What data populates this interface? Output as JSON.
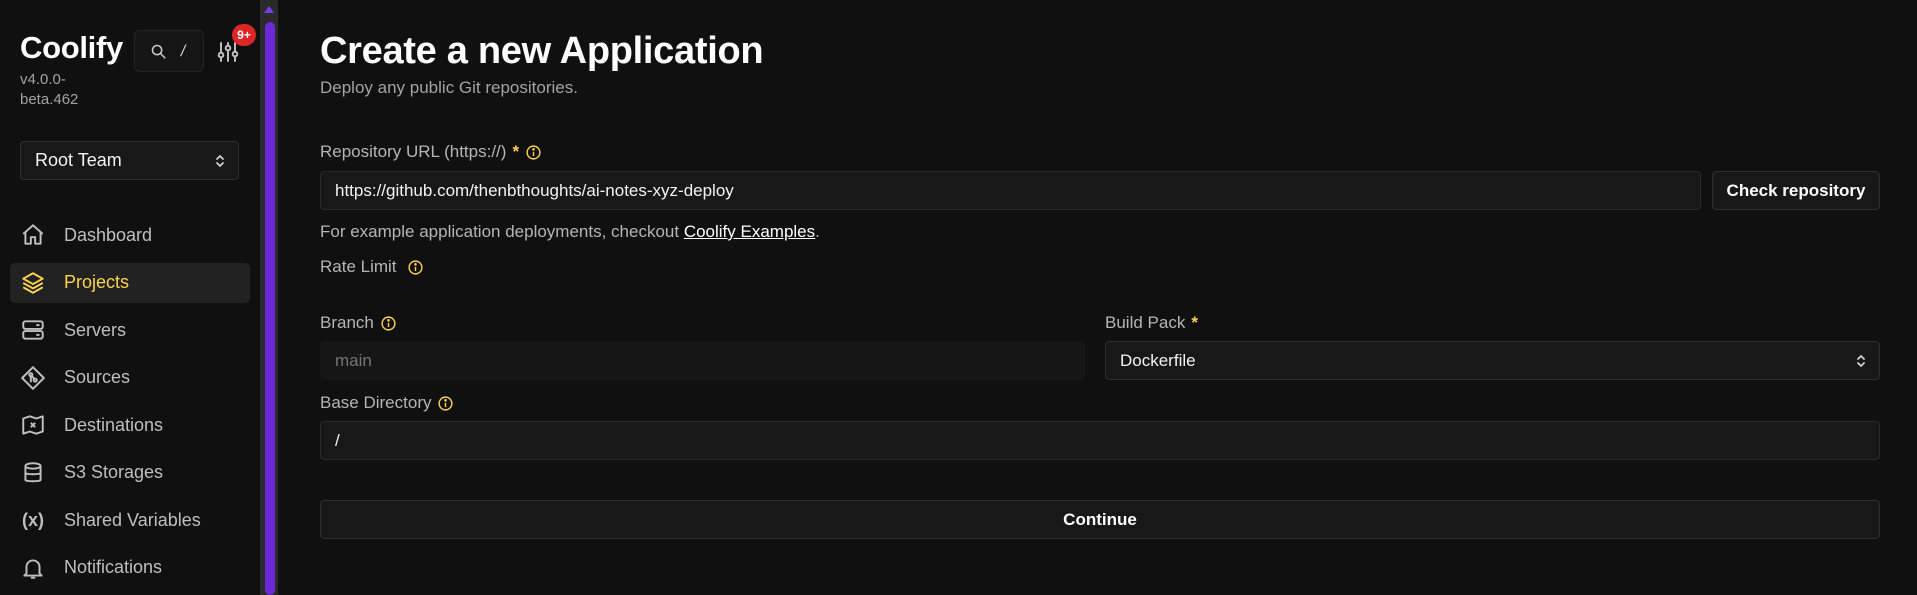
{
  "sidebar": {
    "brand": "Coolify",
    "version": "v4.0.0-beta.462",
    "search_kbd": "/",
    "notification_badge": "9+",
    "team_select": "Root Team",
    "items": [
      {
        "label": "Dashboard",
        "icon": "home-icon"
      },
      {
        "label": "Projects",
        "icon": "layers-icon",
        "active": true
      },
      {
        "label": "Servers",
        "icon": "server-icon"
      },
      {
        "label": "Sources",
        "icon": "git-icon"
      },
      {
        "label": "Destinations",
        "icon": "map-icon"
      },
      {
        "label": "S3 Storages",
        "icon": "database-icon"
      },
      {
        "label": "Shared Variables",
        "icon": "variable-icon",
        "glyph": "(x)"
      },
      {
        "label": "Notifications",
        "icon": "bell-icon"
      }
    ]
  },
  "main": {
    "title": "Create a new Application",
    "subtitle": "Deploy any public Git repositories.",
    "repo_label": "Repository URL (https://)",
    "repo_value": "https://github.com/thenbthoughts/ai-notes-xyz-deploy",
    "check_button": "Check repository",
    "help_prefix": "For example application deployments, checkout ",
    "help_link": "Coolify Examples",
    "help_suffix": ".",
    "rate_limit_label": "Rate Limit",
    "branch_label": "Branch",
    "branch_placeholder": "main",
    "build_pack_label": "Build Pack",
    "build_pack_value": "Dockerfile",
    "base_dir_label": "Base Directory",
    "base_dir_value": "/",
    "continue_button": "Continue"
  },
  "colors": {
    "accent": "#fcd34d",
    "scrollbar": "#6d28d9",
    "badge": "#dc2626"
  }
}
